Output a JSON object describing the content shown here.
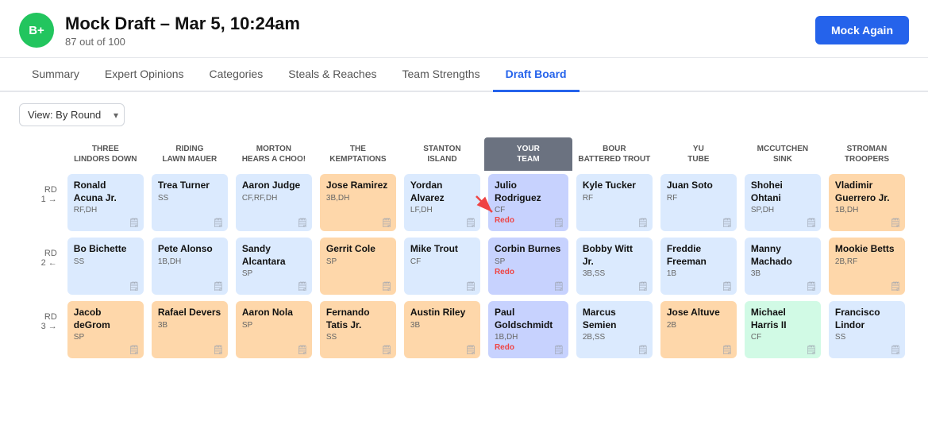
{
  "header": {
    "grade": "B+",
    "title": "Mock Draft – Mar 5, 10:24am",
    "subtitle": "87 out of 100",
    "mock_again_label": "Mock Again"
  },
  "nav": {
    "items": [
      {
        "label": "Summary",
        "active": false
      },
      {
        "label": "Expert Opinions",
        "active": false
      },
      {
        "label": "Categories",
        "active": false
      },
      {
        "label": "Steals & Reaches",
        "active": false
      },
      {
        "label": "Team Strengths",
        "active": false
      },
      {
        "label": "Draft Board",
        "active": true
      }
    ]
  },
  "toolbar": {
    "view_label": "View: By Round"
  },
  "board": {
    "columns": [
      {
        "id": "three-lindors-down",
        "label": "THREE LINDORS DOWN"
      },
      {
        "id": "riding-lawn-mauer",
        "label": "RIDING LAWN MAUER"
      },
      {
        "id": "morton-hears-a-choo",
        "label": "MORTON HEARS A CHOO!"
      },
      {
        "id": "the-kemptations",
        "label": "THE KEMPTATIONS"
      },
      {
        "id": "stanton-island",
        "label": "STANTON ISLAND"
      },
      {
        "id": "your-team",
        "label": "YOUR TEAM",
        "isYours": true
      },
      {
        "id": "bour-battered-trout",
        "label": "BOUR BATTERED TROUT"
      },
      {
        "id": "yu-tube",
        "label": "YU TUBE"
      },
      {
        "id": "mccutchen-sink",
        "label": "MCCUTCHEN SINK"
      },
      {
        "id": "stroman-troopers",
        "label": "STROMAN TROOPERS"
      }
    ],
    "rounds": [
      {
        "label": "RD 1 →",
        "picks": [
          {
            "name": "Ronald Acuna Jr.",
            "pos": "RF,DH",
            "color": "blue"
          },
          {
            "name": "Trea Turner",
            "pos": "SS",
            "color": "blue"
          },
          {
            "name": "Aaron Judge",
            "pos": "CF,RF,DH",
            "color": "blue"
          },
          {
            "name": "Jose Ramirez",
            "pos": "3B,DH",
            "color": "orange"
          },
          {
            "name": "Yordan Alvarez",
            "pos": "LF,DH",
            "color": "blue"
          },
          {
            "name": "Julio Rodriguez",
            "pos": "CF",
            "color": "your-team",
            "redo": "Redo"
          },
          {
            "name": "Kyle Tucker",
            "pos": "RF",
            "color": "blue"
          },
          {
            "name": "Juan Soto",
            "pos": "RF",
            "color": "blue"
          },
          {
            "name": "Shohei Ohtani",
            "pos": "SP,DH",
            "color": "blue"
          },
          {
            "name": "Vladimir Guerrero Jr.",
            "pos": "1B,DH",
            "color": "orange"
          }
        ]
      },
      {
        "label": "RD 2 ←",
        "picks": [
          {
            "name": "Bo Bichette",
            "pos": "SS",
            "color": "blue"
          },
          {
            "name": "Pete Alonso",
            "pos": "1B,DH",
            "color": "blue"
          },
          {
            "name": "Sandy Alcantara",
            "pos": "SP",
            "color": "blue"
          },
          {
            "name": "Gerrit Cole",
            "pos": "SP",
            "color": "orange"
          },
          {
            "name": "Mike Trout",
            "pos": "CF",
            "color": "blue"
          },
          {
            "name": "Corbin Burnes",
            "pos": "SP",
            "color": "your-team",
            "redo": "Redo"
          },
          {
            "name": "Bobby Witt Jr.",
            "pos": "3B,SS",
            "color": "blue"
          },
          {
            "name": "Freddie Freeman",
            "pos": "1B",
            "color": "blue"
          },
          {
            "name": "Manny Machado",
            "pos": "3B",
            "color": "blue"
          },
          {
            "name": "Mookie Betts",
            "pos": "2B,RF",
            "color": "orange"
          }
        ]
      },
      {
        "label": "RD 3 →",
        "picks": [
          {
            "name": "Jacob deGrom",
            "pos": "SP",
            "color": "orange"
          },
          {
            "name": "Rafael Devers",
            "pos": "3B",
            "color": "orange"
          },
          {
            "name": "Aaron Nola",
            "pos": "SP",
            "color": "orange"
          },
          {
            "name": "Fernando Tatis Jr.",
            "pos": "SS",
            "color": "orange"
          },
          {
            "name": "Austin Riley",
            "pos": "3B",
            "color": "orange"
          },
          {
            "name": "Paul Goldschmidt",
            "pos": "1B,DH",
            "color": "your-team",
            "redo": "Redo"
          },
          {
            "name": "Marcus Semien",
            "pos": "2B,SS",
            "color": "blue"
          },
          {
            "name": "Jose Altuve",
            "pos": "2B",
            "color": "orange"
          },
          {
            "name": "Michael Harris II",
            "pos": "CF",
            "color": "green"
          },
          {
            "name": "Francisco Lindor",
            "pos": "SS",
            "color": "blue"
          }
        ]
      }
    ]
  }
}
